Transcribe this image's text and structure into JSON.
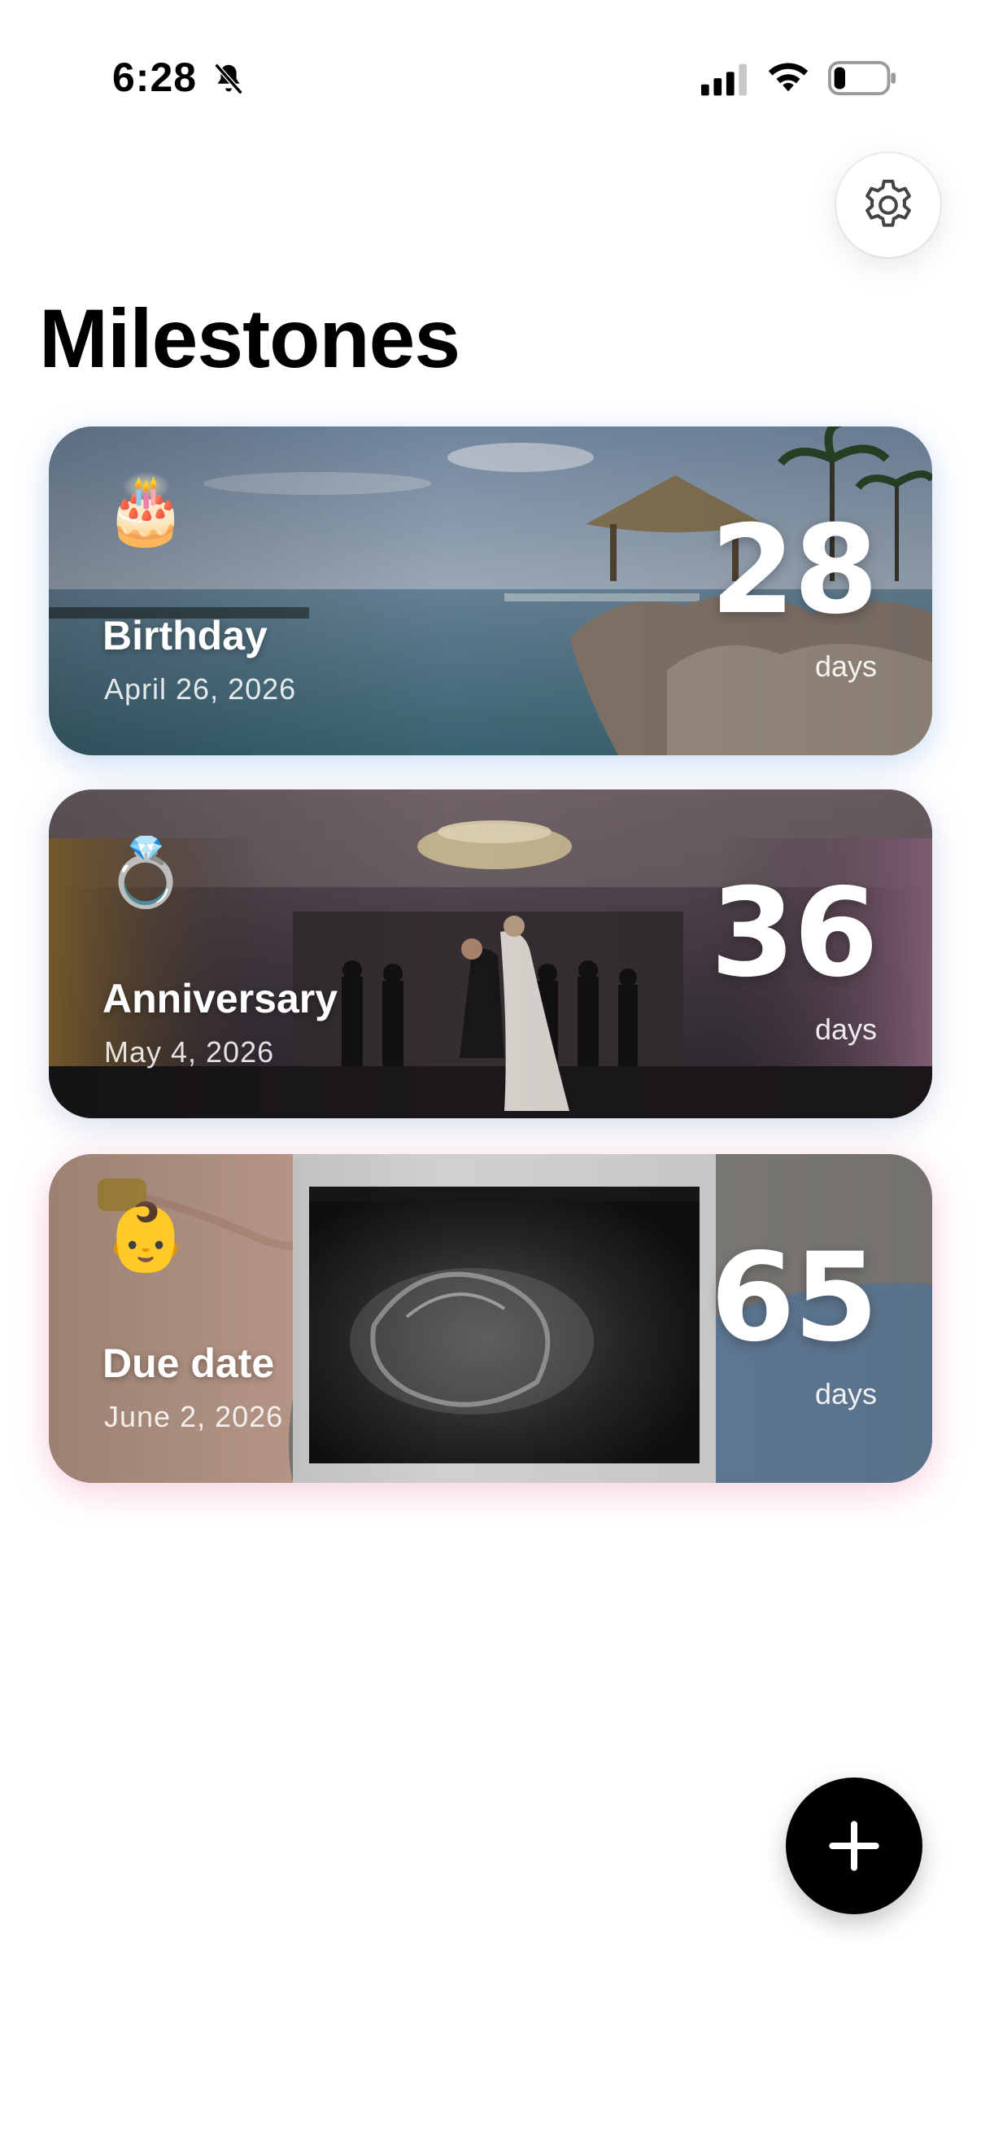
{
  "status_bar": {
    "time": "6:28",
    "icons": [
      "bell-slash-icon",
      "cellular-signal-icon",
      "wifi-icon",
      "battery-icon"
    ]
  },
  "header": {
    "title": "Milestones",
    "settings_icon": "gear-icon"
  },
  "milestones": [
    {
      "emoji": "🎂",
      "name": "Birthday",
      "date": "April 26, 2026",
      "count": "28",
      "unit": "days",
      "glow_color": "#8cb4e6"
    },
    {
      "emoji": "💍",
      "name": "Anniversary",
      "date": "May 4, 2026",
      "count": "36",
      "unit": "days",
      "glow_color": "#96a0c8"
    },
    {
      "emoji": "👶",
      "name": "Due date",
      "date": "June 2, 2026",
      "count": "65",
      "unit": "days",
      "glow_color": "#f096b4"
    }
  ],
  "fab": {
    "icon": "plus-icon"
  }
}
